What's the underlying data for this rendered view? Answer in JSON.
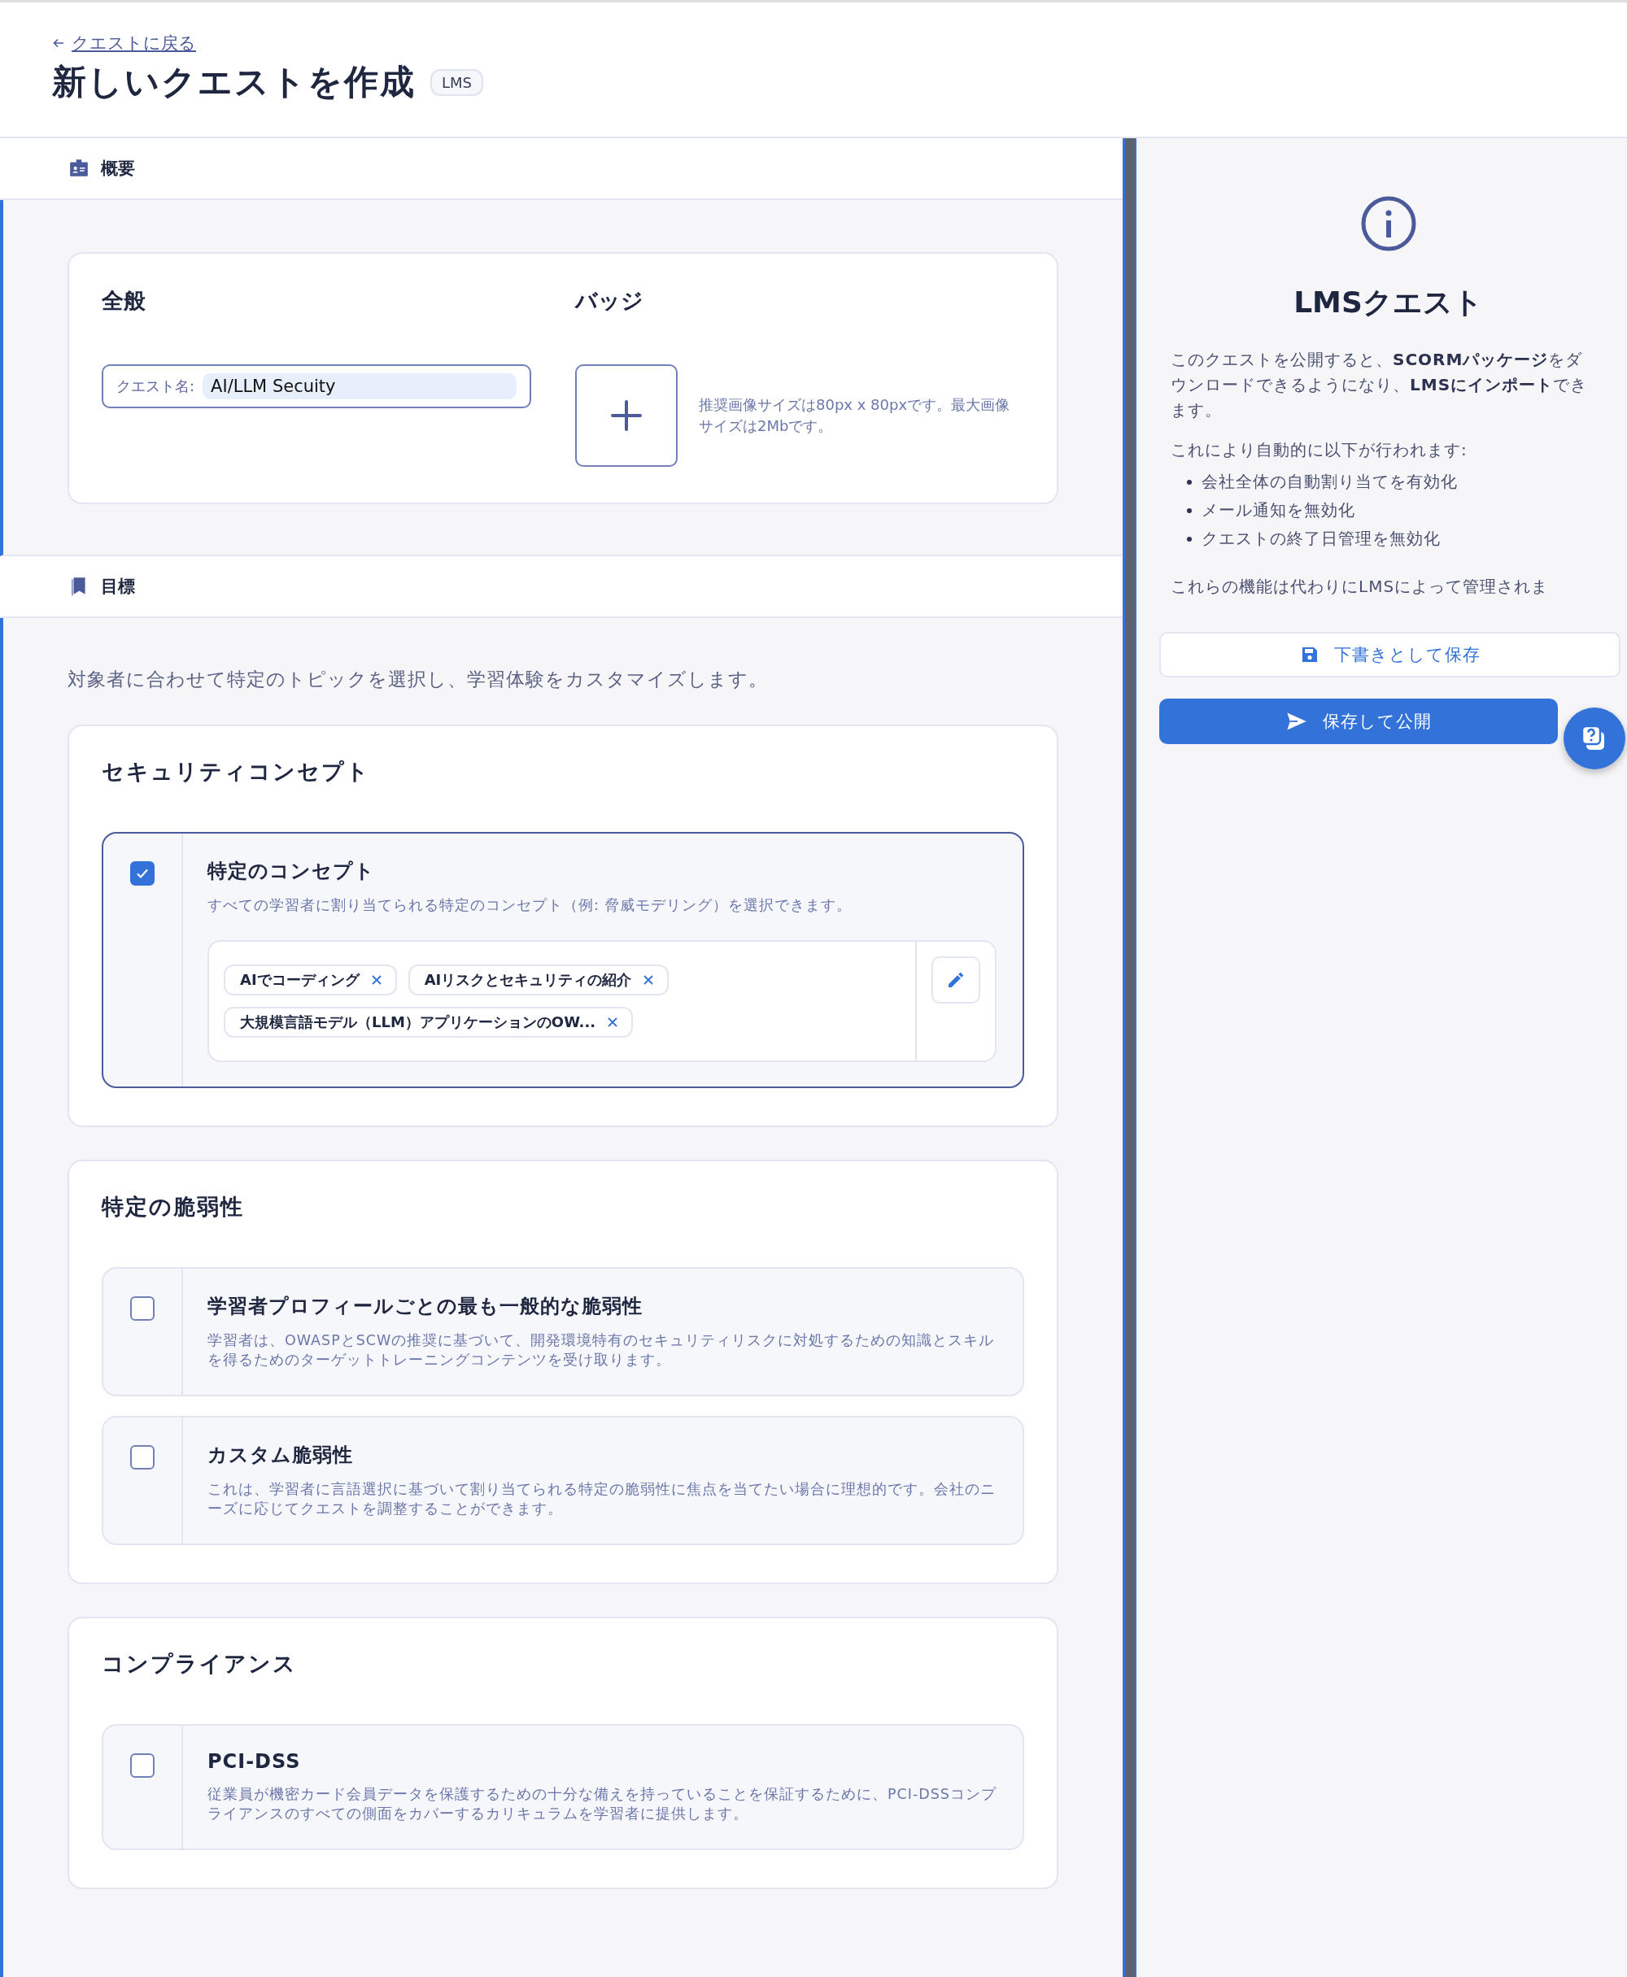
{
  "back_link": {
    "label": "クエストに戻る"
  },
  "title": "新しいクエストを作成",
  "title_badge": "LMS",
  "overview": {
    "title": "概要",
    "general": {
      "heading": "全般",
      "field": {
        "label": "クエスト名:",
        "value": "AI/LLM Secuity"
      }
    },
    "badge": {
      "heading": "バッジ",
      "hint": "推奨画像サイズは80px x 80pxです。最大画像サイズは2Mbです。"
    }
  },
  "goals": {
    "title": "目標",
    "intro": "対象者に合わせて特定のトピックを選択し、学習体験をカスタマイズします。",
    "groups": [
      {
        "title": "セキュリティコンセプト",
        "options": [
          {
            "title": "特定のコンセプト",
            "description": "すべての学習者に割り当てられる特定のコンセプト（例: 脅威モデリング）を選択できます。",
            "checked": true,
            "tags": [
              "AIでコーディング",
              "AIリスクとセキュリティの紹介",
              "大規模言語モデル（LLM）アプリケーションのOW..."
            ]
          }
        ]
      },
      {
        "title": "特定の脆弱性",
        "options": [
          {
            "title": "学習者プロフィールごとの最も一般的な脆弱性",
            "description": "学習者は、OWASPとSCWの推奨に基づいて、開発環境特有のセキュリティリスクに対処するための知識とスキルを得るためのターゲットトレーニングコンテンツを受け取ります。",
            "checked": false
          },
          {
            "title": "カスタム脆弱性",
            "description": "これは、学習者に言語選択に基づいて割り当てられる特定の脆弱性に焦点を当てたい場合に理想的です。会社のニーズに応じてクエストを調整することができます。",
            "checked": false
          }
        ]
      },
      {
        "title": "コンプライアンス",
        "options": [
          {
            "title": "PCI-DSS",
            "description": "従業員が機密カード会員データを保護するための十分な備えを持っていることを保証するために、PCI-DSSコンプライアンスのすべての側面をカバーするカリキュラムを学習者に提供します。",
            "checked": false
          }
        ]
      }
    ]
  },
  "sidebar": {
    "title": "LMSクエスト",
    "paragraph": "このクエストを公開すると、**SCORMパッケージ**をダウンロードできるようになり、**LMSにインポート**できます。",
    "lead": "これにより自動的に以下が行われます:",
    "bullets": [
      "会社全体の自動割り当てを有効化",
      "メール通知を無効化",
      "クエストの終了日管理を無効化"
    ],
    "note": "これらの機能は代わりにLMSによって管理されま",
    "buttons": [
      {
        "kind": "secondary",
        "label": "下書きとして保存"
      },
      {
        "kind": "primary",
        "label": "保存して公開"
      }
    ]
  }
}
